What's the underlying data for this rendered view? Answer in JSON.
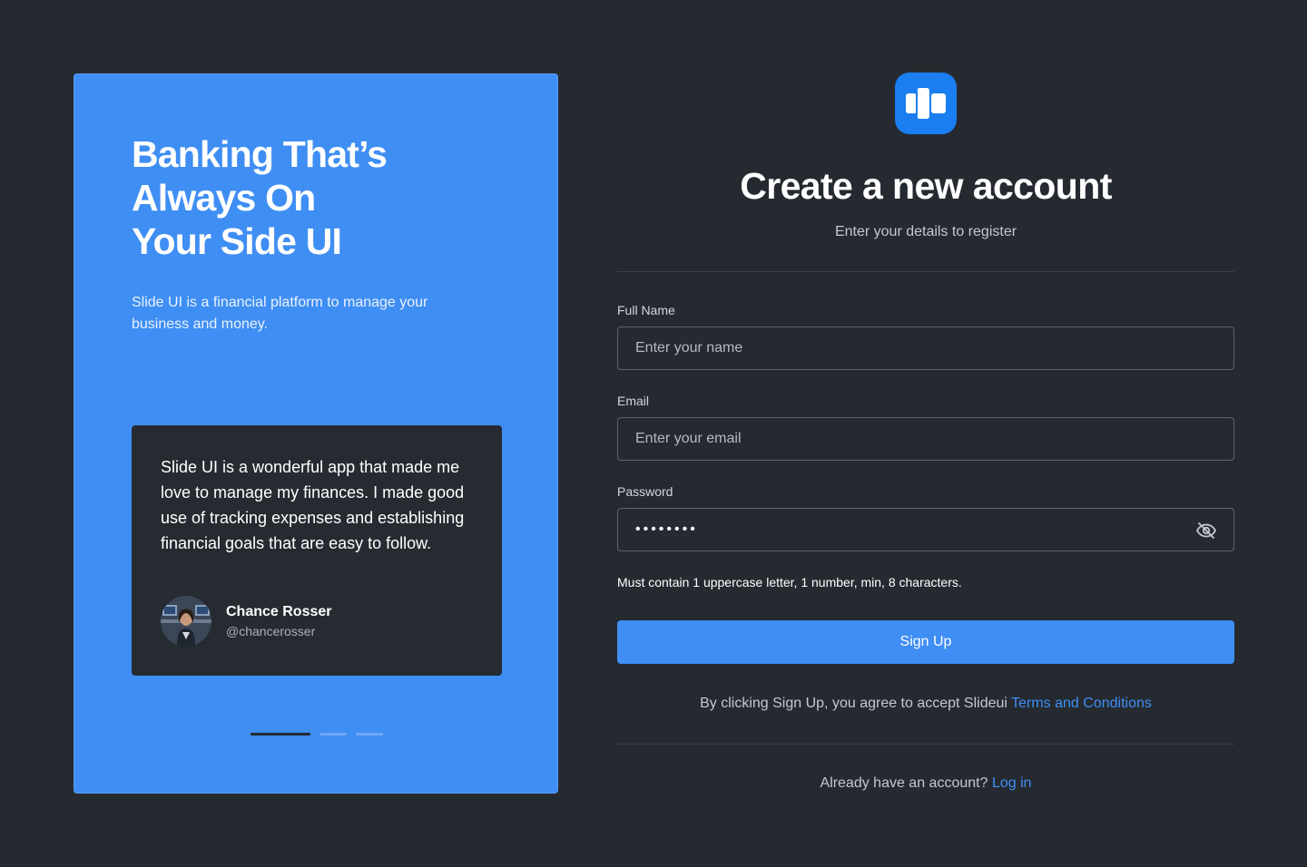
{
  "promo": {
    "heading_lines": [
      "Banking That’s",
      "Always On",
      "Your Side UI"
    ],
    "description": "Slide UI is a financial platform to manage your business and money.",
    "testimonial": {
      "quote": "Slide UI is a wonderful app that made me love to manage my finances. I made good use of tracking expenses and establishing financial goals that are easy to follow.",
      "author_name": "Chance Rosser",
      "author_handle": "@chancerosser"
    },
    "carousel": {
      "total": 3,
      "active_index": 0
    }
  },
  "form": {
    "title": "Create a new account",
    "subtitle": "Enter your details to register",
    "full_name": {
      "label": "Full Name",
      "placeholder": "Enter your name",
      "value": ""
    },
    "email": {
      "label": "Email",
      "placeholder": "Enter your email",
      "value": ""
    },
    "password": {
      "label": "Password",
      "value": "••••••••"
    },
    "password_hint": "Must contain 1 uppercase letter, 1 number, min, 8 characters.",
    "submit_label": "Sign Up",
    "terms_text": "By clicking Sign Up, you agree to accept Slideui",
    "terms_link": "Terms and Conditions",
    "login_text": "Already have an account?",
    "login_link": "Log in"
  },
  "colors": {
    "background": "#252a31",
    "accent": "#3f8ef3",
    "logo": "#1a7ef0"
  },
  "icons": {
    "logo": "slide-ui-logo-icon",
    "password_toggle": "eye-off-icon"
  }
}
